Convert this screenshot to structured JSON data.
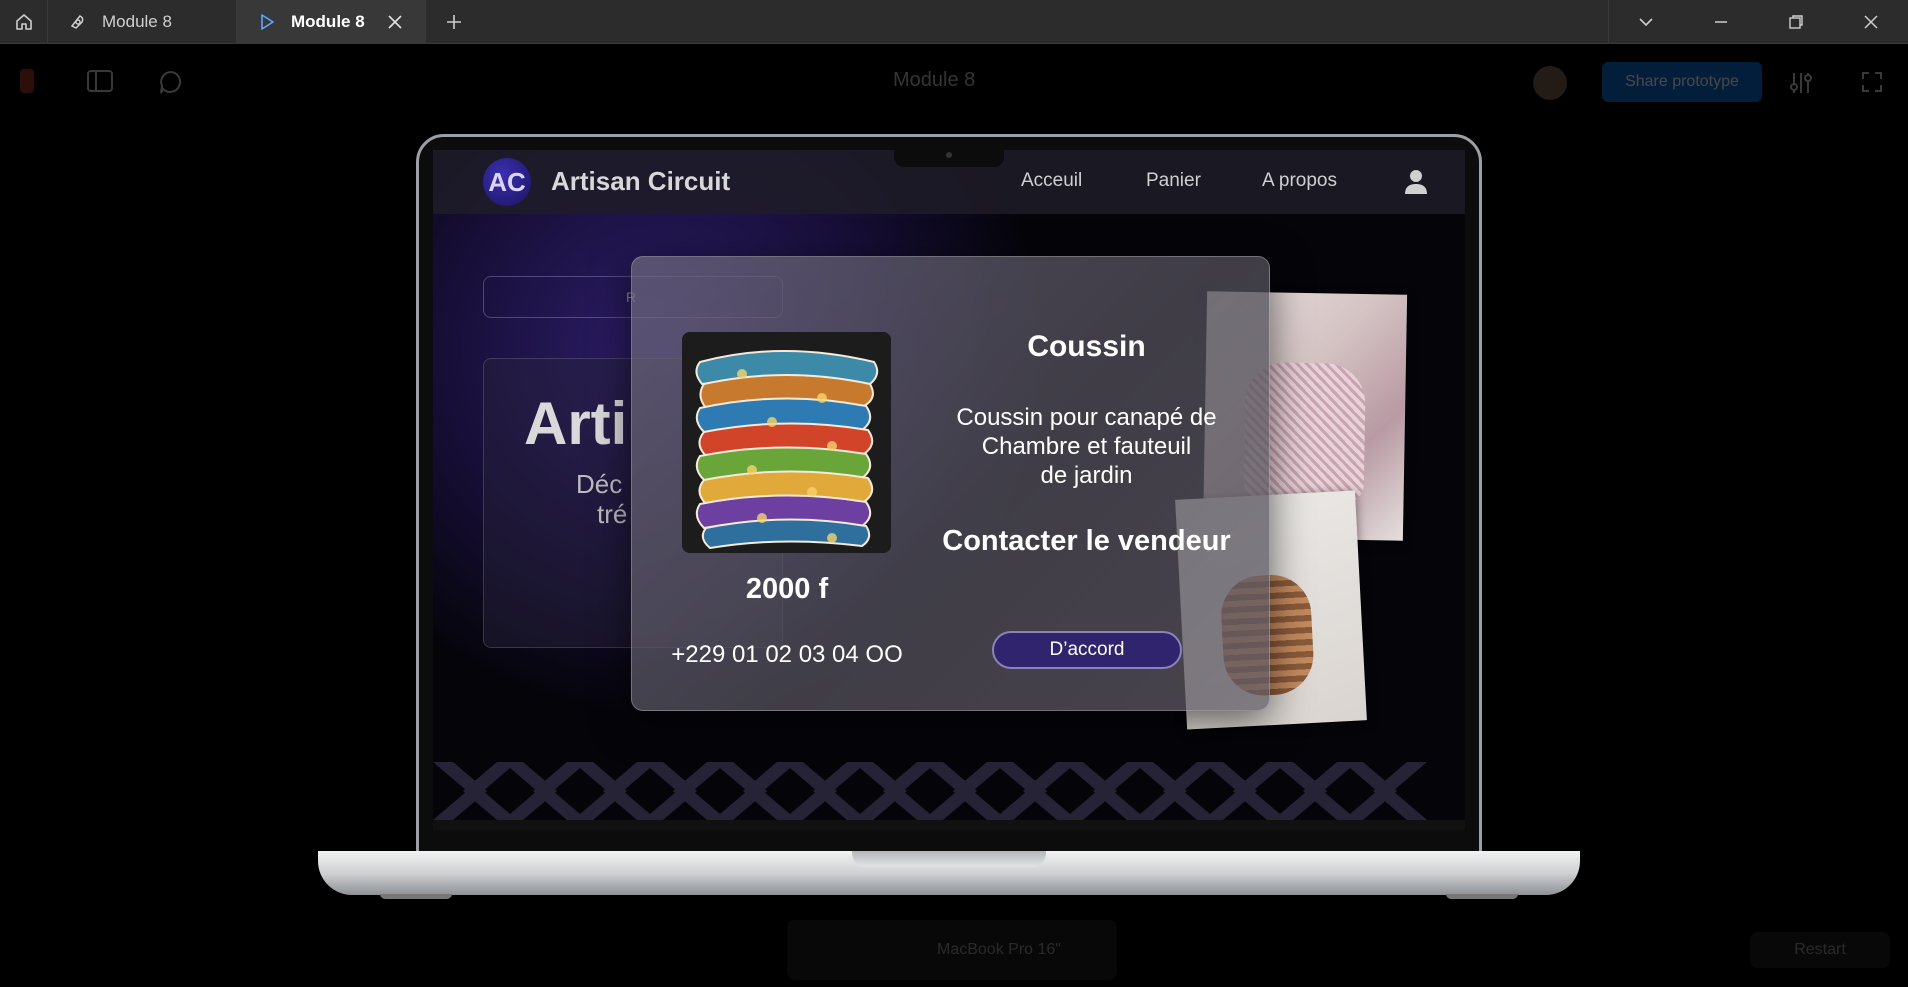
{
  "tabs": [
    {
      "label": "Module 8"
    },
    {
      "label": "Module 8"
    }
  ],
  "viewer": {
    "file_title": "Module 8",
    "share_label": "Share prototype",
    "device_label": "MacBook Pro 16\"",
    "restart_label": "Restart"
  },
  "site": {
    "logo_initials": "AC",
    "brand": "Artisan Circuit",
    "nav": [
      "Acceuil",
      "Panier",
      "A propos"
    ],
    "search_placeholder": "R",
    "hero_title": "Arti",
    "hero_sub_line1": "Déc",
    "hero_sub_line2": "tré"
  },
  "modal": {
    "product_name": "Coussin",
    "description_lines": [
      "Coussin pour canapé de",
      "Chambre et fauteuil",
      "de jardin"
    ],
    "contact_heading": "Contacter le vendeur",
    "price": "2000 f",
    "phone": "+229 01 02 03 04 OO",
    "ok_label": "D’accord"
  },
  "colors": {
    "accent_button": "#30246e",
    "tabbar": "#2c2c2c",
    "modal_glass": "#5a5865"
  }
}
